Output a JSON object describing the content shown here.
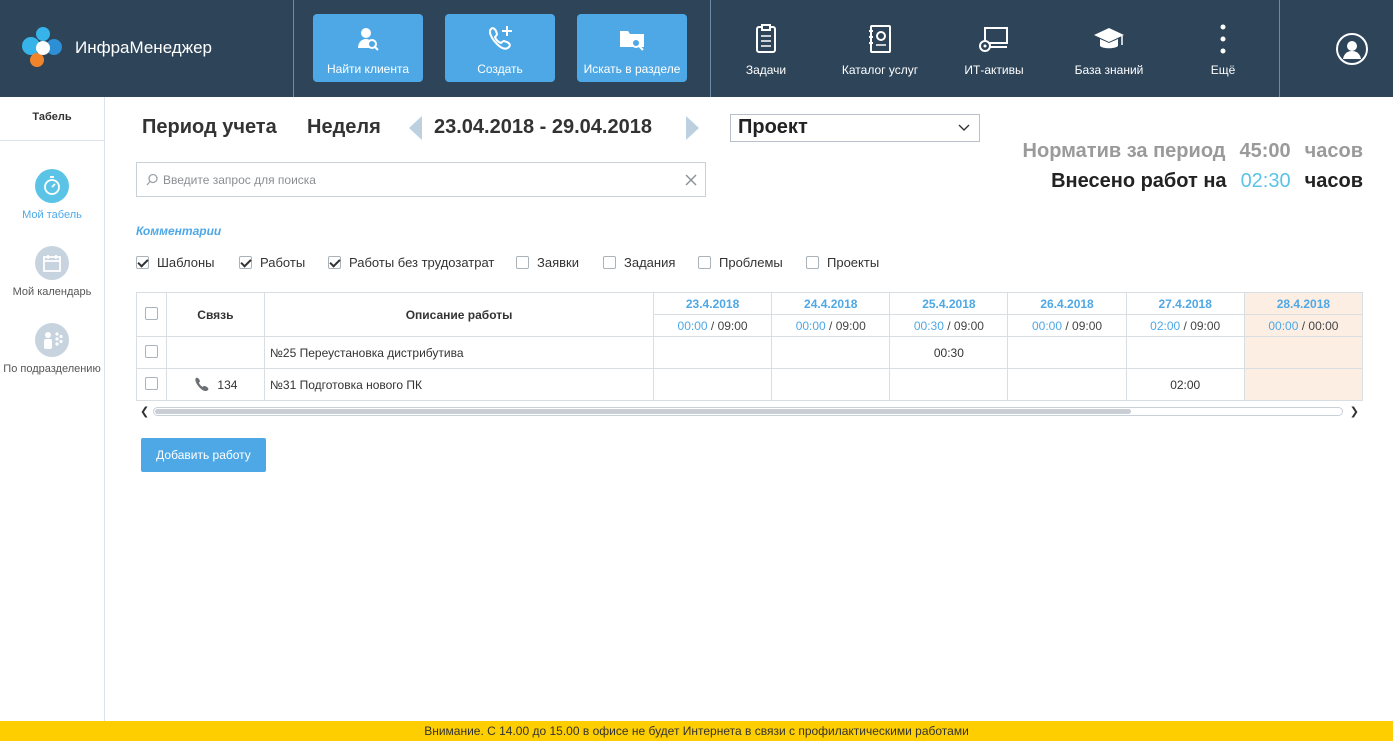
{
  "app": {
    "name": "ИнфраМенеджер"
  },
  "actions": [
    {
      "label": "Найти клиента",
      "icon": "find-client-icon"
    },
    {
      "label": "Создать",
      "icon": "phone-add-icon"
    },
    {
      "label": "Искать в разделе",
      "icon": "folder-search-icon"
    }
  ],
  "nav": [
    {
      "label": "Задачи",
      "icon": "clipboard-icon"
    },
    {
      "label": "Каталог услуг",
      "icon": "catalog-icon"
    },
    {
      "label": "ИТ-активы",
      "icon": "computer-icon"
    },
    {
      "label": "База знаний",
      "icon": "graduation-cap-icon"
    },
    {
      "label": "Ещё",
      "icon": "more-vertical-icon"
    }
  ],
  "sidebar": {
    "header": "Табель",
    "items": [
      {
        "label": "Мой табель",
        "icon": "stopwatch-icon",
        "active": true
      },
      {
        "label": "Мой календарь",
        "icon": "calendar-icon",
        "active": false
      },
      {
        "label": "По подразделению",
        "icon": "people-icon",
        "active": false
      }
    ]
  },
  "period": {
    "label": "Период учета",
    "type": "Неделя",
    "range": "23.04.2018 - 29.04.2018"
  },
  "project_select": {
    "value": "Проект"
  },
  "summary": {
    "norm_label": "Норматив за период",
    "norm_value": "45:00",
    "done_label": "Внесено работ на",
    "done_value": "02:30",
    "unit": "часов"
  },
  "search": {
    "placeholder": "Введите запрос для поиска",
    "value": ""
  },
  "comments_link": "Комментарии",
  "filters": [
    {
      "label": "Шаблоны",
      "checked": true
    },
    {
      "label": "Работы",
      "checked": true
    },
    {
      "label": "Работы без трудозатрат",
      "checked": true
    },
    {
      "label": "Заявки",
      "checked": false
    },
    {
      "label": "Задания",
      "checked": false
    },
    {
      "label": "Проблемы",
      "checked": false
    },
    {
      "label": "Проекты",
      "checked": false
    }
  ],
  "table": {
    "col_link": "Связь",
    "col_desc": "Описание работы",
    "days": [
      {
        "date": "23.4.2018",
        "done": "00:00",
        "plan": "09:00",
        "weekend": false
      },
      {
        "date": "24.4.2018",
        "done": "00:00",
        "plan": "09:00",
        "weekend": false
      },
      {
        "date": "25.4.2018",
        "done": "00:30",
        "plan": "09:00",
        "weekend": false
      },
      {
        "date": "26.4.2018",
        "done": "00:00",
        "plan": "09:00",
        "weekend": false
      },
      {
        "date": "27.4.2018",
        "done": "02:00",
        "plan": "09:00",
        "weekend": false
      },
      {
        "date": "28.4.2018",
        "done": "00:00",
        "plan": "00:00",
        "weekend": true
      }
    ],
    "rows": [
      {
        "link_icon": "",
        "link": "",
        "desc": "№25 Переустановка дистрибутива",
        "hours": [
          "",
          "",
          "00:30",
          "",
          "",
          ""
        ]
      },
      {
        "link_icon": "phone-icon",
        "link": "134",
        "desc": "№31 Подготовка нового ПК",
        "hours": [
          "",
          "",
          "",
          "",
          "02:00",
          ""
        ]
      }
    ]
  },
  "add_button": "Добавить работу",
  "notice": "Внимание. С 14.00 до 15.00 в офисе не будет Интернета в связи с профилактическими работами",
  "colors": {
    "topbar": "#2d4459",
    "accent": "#4ea8e6",
    "notice": "#ffce00",
    "weekend": "#fdeee4"
  }
}
